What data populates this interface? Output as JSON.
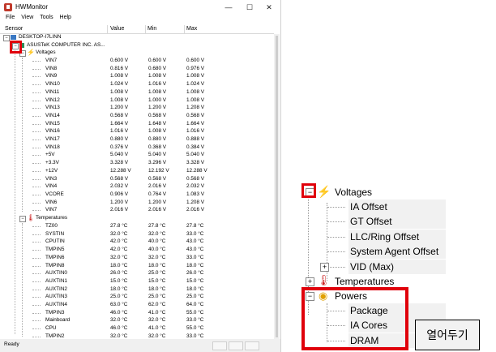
{
  "window": {
    "title": "HWMonitor",
    "controls": {
      "minimize": "—",
      "maximize": "☐",
      "close": "✕"
    },
    "menu": [
      "File",
      "View",
      "Tools",
      "Help"
    ],
    "columns": [
      "Sensor",
      "Value",
      "Min",
      "Max"
    ],
    "computer": "DESKTOP-I7LINN",
    "board": "ASUSTeK COMPUTER INC. AS...",
    "voltages_label": "Voltages",
    "voltages": [
      [
        "VIN7",
        "0.600 V",
        "0.600 V",
        "0.600 V"
      ],
      [
        "VIN8",
        "0.816 V",
        "0.680 V",
        "0.976 V"
      ],
      [
        "VIN9",
        "1.008 V",
        "1.008 V",
        "1.008 V"
      ],
      [
        "VIN10",
        "1.024 V",
        "1.016 V",
        "1.024 V"
      ],
      [
        "VIN11",
        "1.008 V",
        "1.008 V",
        "1.008 V"
      ],
      [
        "VIN12",
        "1.008 V",
        "1.000 V",
        "1.008 V"
      ],
      [
        "VIN13",
        "1.200 V",
        "1.200 V",
        "1.208 V"
      ],
      [
        "VIN14",
        "0.568 V",
        "0.568 V",
        "0.568 V"
      ],
      [
        "VIN15",
        "1.664 V",
        "1.648 V",
        "1.664 V"
      ],
      [
        "VIN16",
        "1.016 V",
        "1.008 V",
        "1.016 V"
      ],
      [
        "VIN17",
        "0.880 V",
        "0.880 V",
        "0.888 V"
      ],
      [
        "VIN18",
        "0.376 V",
        "0.368 V",
        "0.384 V"
      ],
      [
        "+5V",
        "5.040 V",
        "5.040 V",
        "5.040 V"
      ],
      [
        "+3.3V",
        "3.328 V",
        "3.296 V",
        "3.328 V"
      ],
      [
        "+12V",
        "12.288 V",
        "12.192 V",
        "12.288 V"
      ],
      [
        "VIN3",
        "0.568 V",
        "0.568 V",
        "0.568 V"
      ],
      [
        "VIN4",
        "2.032 V",
        "2.016 V",
        "2.032 V"
      ],
      [
        "VCORE",
        "0.906 V",
        "0.764 V",
        "1.083 V"
      ],
      [
        "VIN6",
        "1.200 V",
        "1.200 V",
        "1.208 V"
      ],
      [
        "VIN7",
        "2.016 V",
        "2.016 V",
        "2.016 V"
      ]
    ],
    "temperatures_label": "Temperatures",
    "temperatures": [
      [
        "TZ00",
        "27.8 °C",
        "27.8 °C",
        "27.8 °C"
      ],
      [
        "SYSTIN",
        "32.0 °C",
        "32.0 °C",
        "33.0 °C"
      ],
      [
        "CPUTIN",
        "42.0 °C",
        "40.0 °C",
        "43.0 °C"
      ],
      [
        "TMPIN5",
        "42.0 °C",
        "40.0 °C",
        "43.0 °C"
      ],
      [
        "TMPIN6",
        "32.0 °C",
        "32.0 °C",
        "33.0 °C"
      ],
      [
        "TMPIN8",
        "18.0 °C",
        "18.0 °C",
        "18.0 °C"
      ],
      [
        "AUXTIN0",
        "26.0 °C",
        "25.0 °C",
        "26.0 °C"
      ],
      [
        "AUXTIN1",
        "15.0 °C",
        "15.0 °C",
        "15.0 °C"
      ],
      [
        "AUXTIN2",
        "18.0 °C",
        "18.0 °C",
        "18.0 °C"
      ],
      [
        "AUXTIN3",
        "25.0 °C",
        "25.0 °C",
        "25.0 °C"
      ],
      [
        "AUXTIN4",
        "63.0 °C",
        "62.0 °C",
        "64.0 °C"
      ],
      [
        "TMPIN3",
        "46.0 °C",
        "41.0 °C",
        "55.0 °C"
      ],
      [
        "Mainboard",
        "32.0 °C",
        "32.0 °C",
        "33.0 °C"
      ],
      [
        "CPU",
        "46.0 °C",
        "41.0 °C",
        "55.0 °C"
      ],
      [
        "TMPIN2",
        "32.0 °C",
        "32.0 °C",
        "33.0 °C"
      ]
    ],
    "status": "Ready"
  },
  "zoom": {
    "voltages_label": "Voltages",
    "voltage_items": [
      "IA Offset",
      "GT Offset",
      "LLC/Ring Offset",
      "System Agent Offset",
      "VID (Max)"
    ],
    "temperatures_label": "Temperatures",
    "powers_label": "Powers",
    "power_items": [
      "Package",
      "IA Cores",
      "DRAM"
    ]
  },
  "note": "열어두기",
  "colors": {
    "highlight": "#e0000b",
    "shade": "#f1f1f1"
  }
}
